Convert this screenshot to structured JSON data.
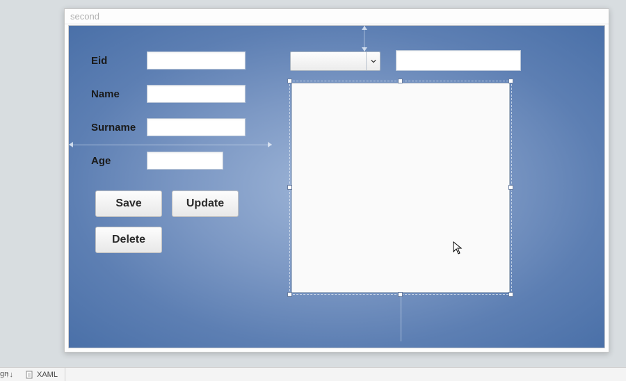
{
  "window": {
    "title": "second"
  },
  "form": {
    "labels": {
      "eid": "Eid",
      "name": "Name",
      "surname": "Surname",
      "age": "Age"
    },
    "values": {
      "eid": "",
      "name": "",
      "surname": "",
      "age": ""
    }
  },
  "combo": {
    "selected": ""
  },
  "right_textbox": {
    "value": ""
  },
  "buttons": {
    "save": "Save",
    "update": "Update",
    "delete": "Delete"
  },
  "tabs": {
    "design_suffix": "gn",
    "xaml": "XAML",
    "swap_glyph": "↑↓"
  }
}
